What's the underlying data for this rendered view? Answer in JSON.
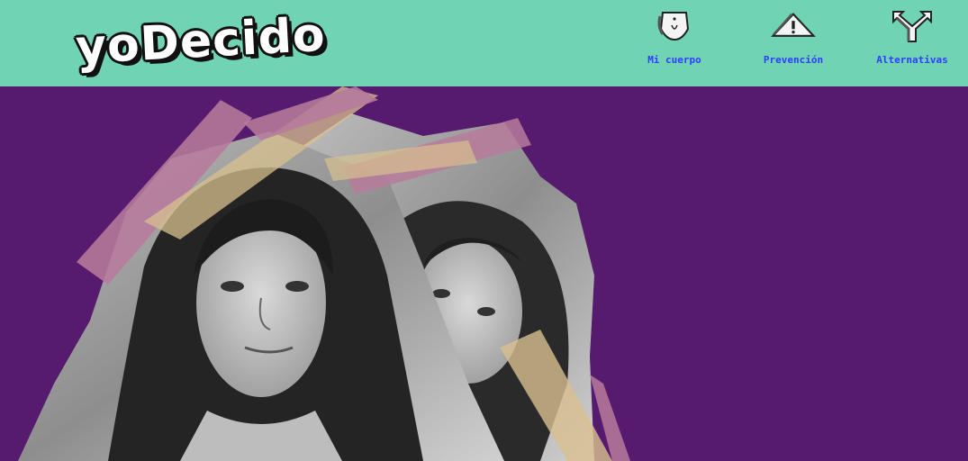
{
  "header": {
    "logo": "yoDecido",
    "nav": [
      {
        "label": "Mi cuerpo",
        "icon": "body-icon"
      },
      {
        "label": "Prevención",
        "icon": "warning-icon"
      },
      {
        "label": "Alternativas",
        "icon": "branch-arrows-icon"
      }
    ]
  },
  "hero": {
    "image": "collage-photo-two-women-taped",
    "colors": {
      "background": "#561a6e",
      "header": "#6fd3b4",
      "tape_pink": "#b77b9c",
      "tape_beige": "#d8c08f"
    }
  }
}
